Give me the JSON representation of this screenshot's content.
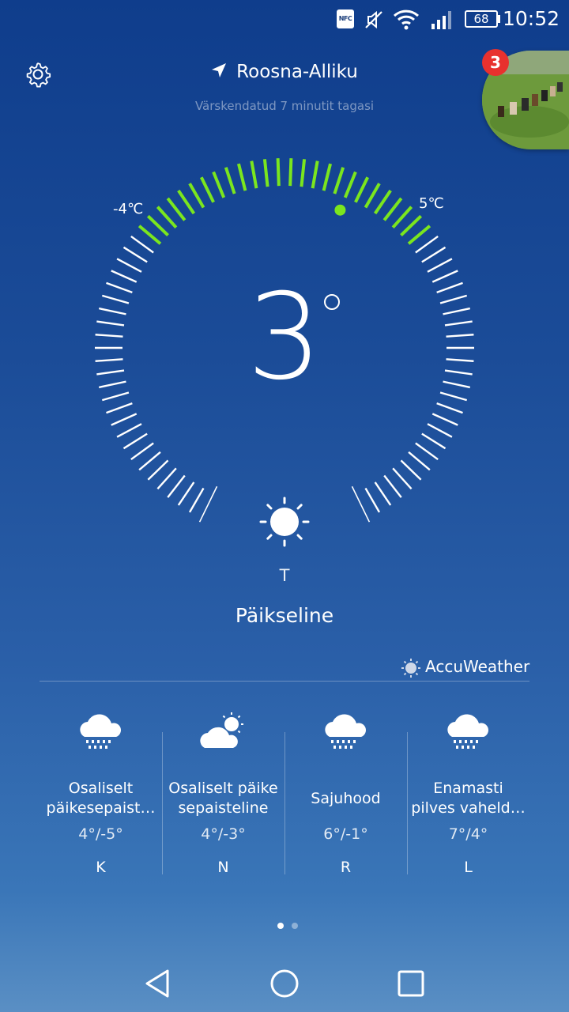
{
  "status_bar": {
    "time": "10:52",
    "battery": "68",
    "nfc": "NFC"
  },
  "header": {
    "city": "Roosna-Alliku",
    "updated": "Värskendatud 7 minutit tagasi",
    "badge_count": "3"
  },
  "current": {
    "temp": "3",
    "min_label": "-4℃",
    "max_label": "5℃",
    "day": "T",
    "condition": "Päikseline"
  },
  "provider": "AccuWeather",
  "forecast": [
    {
      "icon": "rain-cloud-icon",
      "desc_1": "Osaliselt",
      "desc_2": "päikesepaist…",
      "range": "4°/-5°",
      "day": "K"
    },
    {
      "icon": "partly-sunny-icon",
      "desc_1": "Osaliselt päike",
      "desc_2": "sepaisteline",
      "range": "4°/-3°",
      "day": "N"
    },
    {
      "icon": "rain-cloud-icon",
      "desc_1": "Sajuhood",
      "desc_2": "",
      "range": "6°/-1°",
      "day": "R"
    },
    {
      "icon": "rain-cloud-icon",
      "desc_1": "Enamasti",
      "desc_2": "pilves vaheld…",
      "range": "7°/4°",
      "day": "L"
    }
  ],
  "pager": {
    "pages": 2,
    "active": 0
  },
  "colors": {
    "accent_green": "#7be61e"
  }
}
